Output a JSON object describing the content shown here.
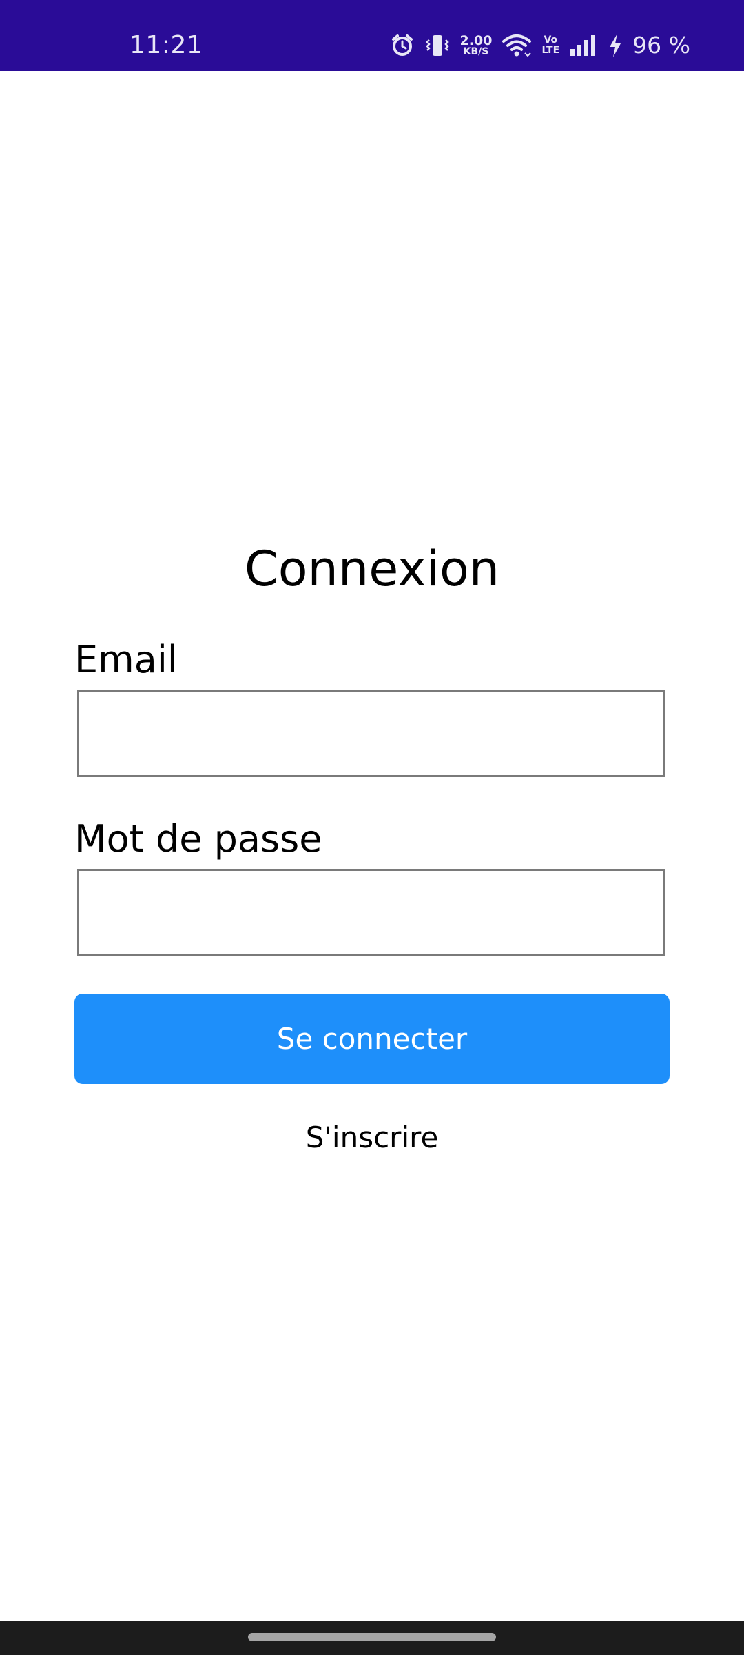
{
  "status_bar": {
    "time": "11:21",
    "net_speed_value": "2.00",
    "net_speed_unit": "KB/S",
    "volte_top": "Vo",
    "volte_bottom": "LTE",
    "battery_percent": "96 %",
    "background_color": "#2a0c97",
    "icons": [
      "alarm-icon",
      "vibrate-icon",
      "wifi-icon",
      "signal-icon",
      "charging-icon"
    ]
  },
  "login": {
    "title": "Connexion",
    "email_label": "Email",
    "email_value": "",
    "password_label": "Mot de passe",
    "password_value": "",
    "submit_label": "Se connecter",
    "register_label": "S'inscrire",
    "accent_color": "#1e8ffa"
  }
}
